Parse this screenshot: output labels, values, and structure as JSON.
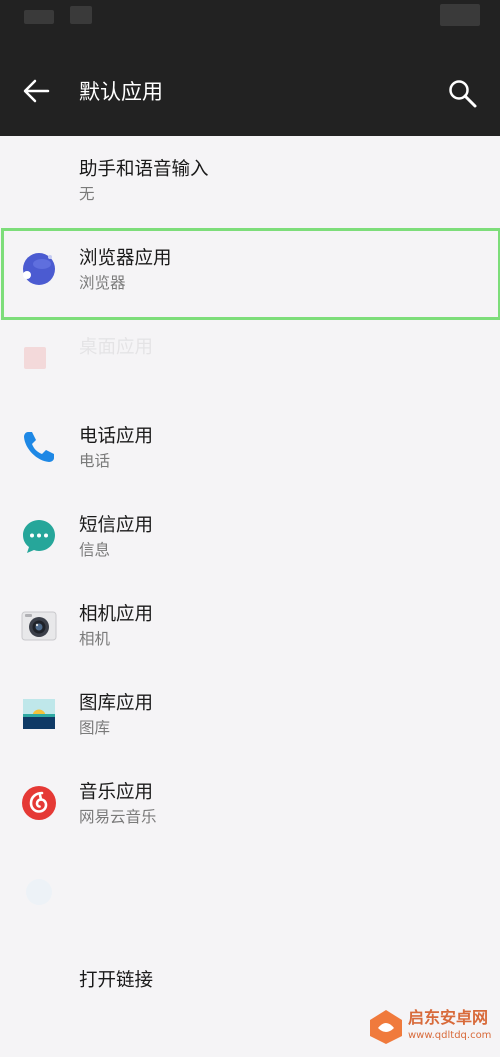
{
  "app_bar": {
    "title": "默认应用"
  },
  "rows": [
    {
      "title": "助手和语音输入",
      "subtitle": "无"
    },
    {
      "title": "浏览器应用",
      "subtitle": "浏览器"
    },
    {
      "title": "桌面应用",
      "subtitle": ""
    },
    {
      "title": "电话应用",
      "subtitle": "电话"
    },
    {
      "title": "短信应用",
      "subtitle": "信息"
    },
    {
      "title": "相机应用",
      "subtitle": "相机"
    },
    {
      "title": "图库应用",
      "subtitle": "图库"
    },
    {
      "title": "音乐应用",
      "subtitle": "网易云音乐"
    },
    {
      "title": "",
      "subtitle": ""
    },
    {
      "title": "打开链接",
      "subtitle": ""
    }
  ],
  "watermark": {
    "brand": "启东安卓网",
    "url": "www.qdltdq.com"
  },
  "colors": {
    "app_bar": "#222222",
    "background": "#f5f4f6",
    "highlight": "#7ddd7a",
    "phone_icon": "#1e88e5",
    "sms_icon": "#26a69a",
    "music_icon": "#e53935"
  },
  "icons": {
    "back": "back-arrow-icon",
    "search": "search-icon",
    "browser": "browser-globe-icon",
    "launcher": "launcher-icon",
    "phone": "phone-icon",
    "sms": "message-bubble-icon",
    "camera": "camera-icon",
    "gallery": "gallery-icon",
    "music": "netease-music-icon"
  }
}
